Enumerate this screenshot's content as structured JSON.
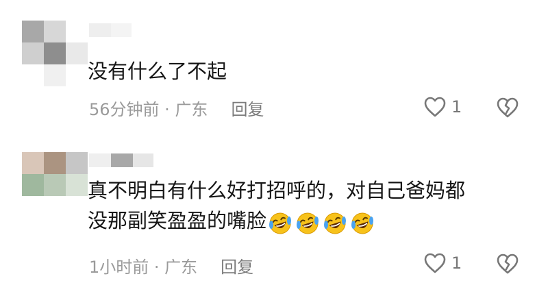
{
  "comments": [
    {
      "text_lines": [
        "没有什么了不起"
      ],
      "time": "56分钟前",
      "separator": " · ",
      "location": "广东",
      "reply_label": "回复",
      "like_count": "1",
      "emoji_count": 0
    },
    {
      "text_lines": [
        "真不明白有什么好打招呼的，对自己爸妈都",
        "没那副笑盈盈的嘴脸"
      ],
      "time": "1小时前",
      "separator": " · ",
      "location": "广东",
      "reply_label": "回复",
      "like_count": "1",
      "emoji_count": 4
    }
  ],
  "icons": {
    "like": "heart-outline-icon",
    "dislike": "broken-heart-icon",
    "emoji": "laughing-tears-emoji"
  },
  "colors": {
    "text": "#161616",
    "meta": "#9a9a9a",
    "icon": "#777777",
    "emoji_face": "#f7c21b"
  }
}
